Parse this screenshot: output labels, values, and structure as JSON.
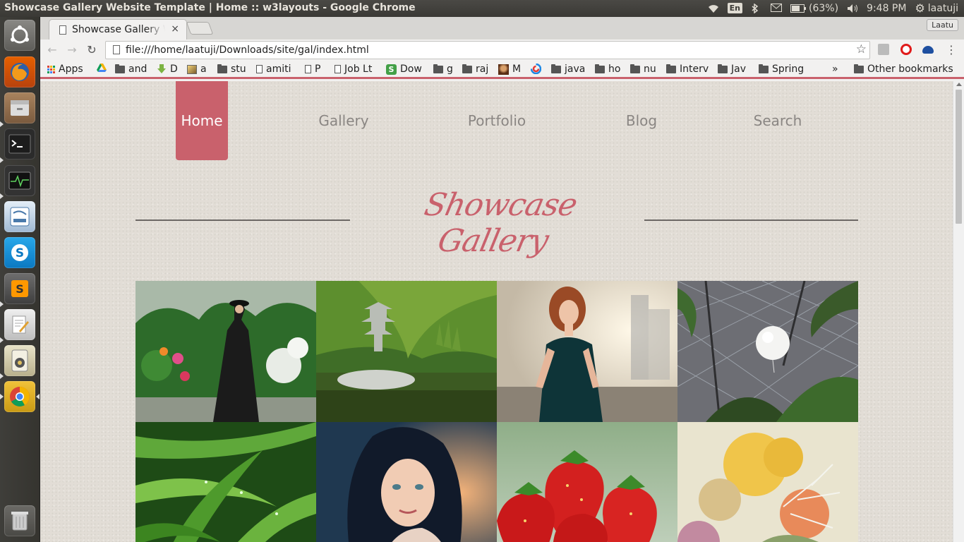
{
  "os": {
    "window_title": "Showcase Gallery Website Template | Home :: w3layouts - Google Chrome",
    "keyboard_layout": "En",
    "battery": "(63%)",
    "clock": "9:48 PM",
    "user": "laatuji"
  },
  "launcher": {
    "icons": [
      "ubuntu-dash",
      "firefox",
      "files",
      "terminal",
      "system-monitor",
      "mysql-workbench",
      "skype",
      "sublime-text",
      "text-editor",
      "rhythmbox",
      "chrome",
      "trash"
    ]
  },
  "browser": {
    "tab_title": "Showcase Gallery W",
    "tab_close": "×",
    "profile_name": "Laatu",
    "url": "file:///home/laatuji/Downloads/site/gal/index.html",
    "bookmarks": [
      {
        "label": "Apps",
        "icon": "apps-icon"
      },
      {
        "label": "",
        "icon": "drive-icon"
      },
      {
        "label": "and",
        "icon": "folder-icon"
      },
      {
        "label": "D",
        "icon": "download-icon"
      },
      {
        "label": "a",
        "icon": "image-icon"
      },
      {
        "label": "stu",
        "icon": "folder-icon"
      },
      {
        "label": "amiti",
        "icon": "page-icon"
      },
      {
        "label": "P",
        "icon": "page-icon"
      },
      {
        "label": "Job Lt",
        "icon": "page-icon"
      },
      {
        "label": "Dow",
        "icon": "green-s-icon"
      },
      {
        "label": "g",
        "icon": "folder-icon"
      },
      {
        "label": "raj",
        "icon": "folder-icon"
      },
      {
        "label": "M",
        "icon": "avatar-icon"
      },
      {
        "label": "",
        "icon": "swirl-icon"
      },
      {
        "label": "java",
        "icon": "folder-icon"
      },
      {
        "label": "ho",
        "icon": "folder-icon"
      },
      {
        "label": "nu",
        "icon": "folder-icon"
      },
      {
        "label": "Interv",
        "icon": "folder-icon"
      },
      {
        "label": "Jav",
        "icon": "folder-icon"
      },
      {
        "label": "Spring",
        "icon": "folder-icon"
      }
    ],
    "overflow": "»",
    "other_bookmarks": "Other bookmarks"
  },
  "site": {
    "nav": [
      "Home",
      "Gallery",
      "Portfolio",
      "Blog",
      "Search"
    ],
    "active_nav": "Home",
    "logo": "Showcase Gallery",
    "accent_color": "#c9616c",
    "photos": [
      "woman-in-black-dress-garden",
      "japanese-pagoda-pond",
      "woman-teal-dress-city",
      "white-balloon-greenhouse",
      "green-leaves-dew",
      "dark-haired-woman-portrait",
      "strawberries",
      "yellow-flowers-bouquet"
    ]
  }
}
